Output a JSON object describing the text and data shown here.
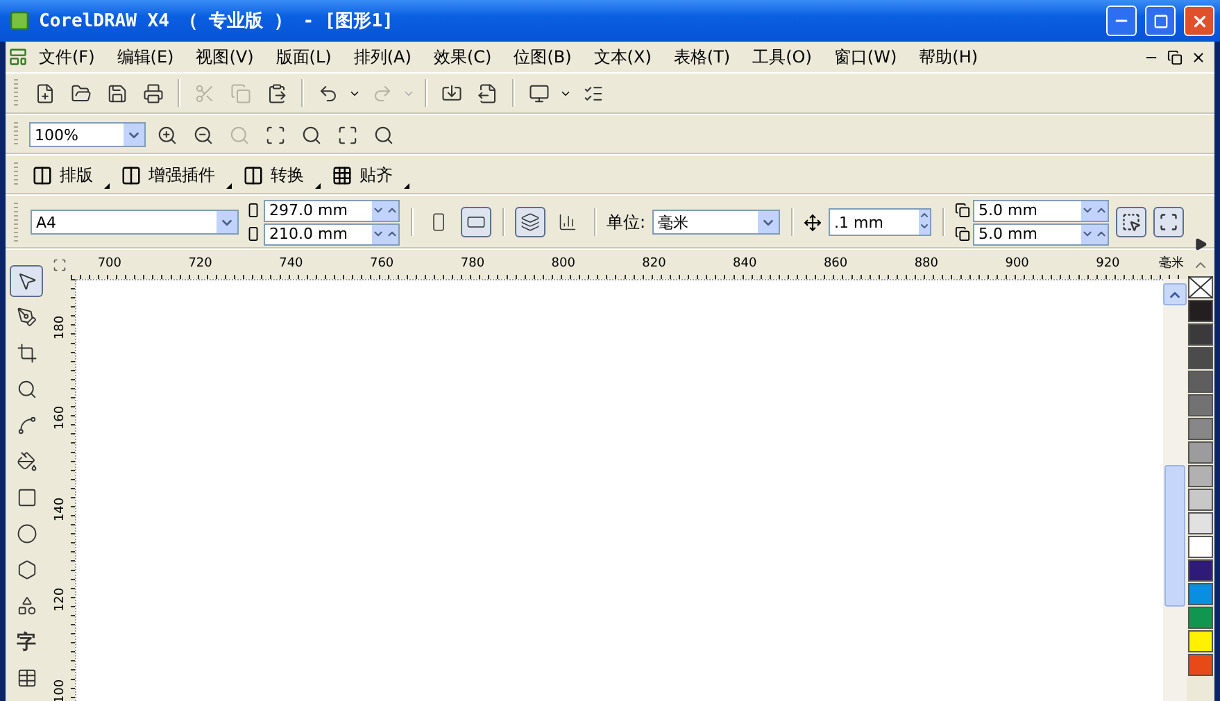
{
  "window": {
    "title": "CorelDRAW X4 （ 专业版 ） - [图形1]"
  },
  "menu": {
    "items": [
      "文件(F)",
      "编辑(E)",
      "视图(V)",
      "版面(L)",
      "排列(A)",
      "效果(C)",
      "位图(B)",
      "文本(X)",
      "表格(T)",
      "工具(O)",
      "窗口(W)",
      "帮助(H)"
    ]
  },
  "zoom_bar": {
    "zoom": "100%"
  },
  "plugin_bar": {
    "items": [
      {
        "kind": "layout",
        "label": "排版"
      },
      {
        "kind": "layout",
        "label": "增强插件"
      },
      {
        "kind": "layout",
        "label": "转换"
      },
      {
        "kind": "snap",
        "label": "贴齐"
      }
    ]
  },
  "property_bar": {
    "paper": "A4",
    "width": "297.0 mm",
    "height": "210.0 mm",
    "orientation": [
      {
        "kind": "portrait",
        "selected": false
      },
      {
        "kind": "landscape",
        "selected": true
      }
    ],
    "page_layout": [
      {
        "kind": "all-pages",
        "selected": true
      },
      {
        "kind": "current-page",
        "selected": false
      }
    ],
    "units_label": "单位:",
    "units": "毫米",
    "nudge": ".1 mm",
    "dup_x": "5.0 mm",
    "dup_y": "5.0 mm"
  },
  "toolbox": [
    {
      "kind": "pick",
      "selected": true
    },
    {
      "kind": "shape",
      "selected": false
    },
    {
      "kind": "crop",
      "selected": false
    },
    {
      "kind": "zoom",
      "selected": false
    },
    {
      "kind": "freehand",
      "selected": false
    },
    {
      "kind": "smart-fill",
      "selected": false
    },
    {
      "kind": "rectangle",
      "selected": false
    },
    {
      "kind": "ellipse",
      "selected": false
    },
    {
      "kind": "polygon",
      "selected": false
    },
    {
      "kind": "basic-shapes",
      "selected": false
    },
    {
      "kind": "text",
      "selected": false,
      "label": "字"
    },
    {
      "kind": "table",
      "selected": false
    }
  ],
  "rulers": {
    "horizontal": [
      "700",
      "720",
      "740",
      "760",
      "780",
      "800",
      "820",
      "840",
      "860",
      "880",
      "900",
      "920"
    ],
    "unit": "毫米",
    "vertical": [
      "180",
      "160",
      "140",
      "120",
      "100"
    ]
  },
  "palette": [
    {
      "kind": "none"
    },
    {
      "kind": "swatch",
      "color": "#231f20"
    },
    {
      "kind": "swatch",
      "color": "#3a3a3a"
    },
    {
      "kind": "swatch",
      "color": "#4b4b4b"
    },
    {
      "kind": "swatch",
      "color": "#5e5e5e"
    },
    {
      "kind": "swatch",
      "color": "#727272"
    },
    {
      "kind": "swatch",
      "color": "#878787"
    },
    {
      "kind": "swatch",
      "color": "#9c9c9c"
    },
    {
      "kind": "swatch",
      "color": "#b1b1b1"
    },
    {
      "kind": "swatch",
      "color": "#c8c8c8"
    },
    {
      "kind": "swatch",
      "color": "#e1e1e1"
    },
    {
      "kind": "swatch",
      "color": "#ffffff"
    },
    {
      "kind": "swatch",
      "color": "#2e1a78"
    },
    {
      "kind": "swatch",
      "color": "#0a8ee0"
    },
    {
      "kind": "swatch",
      "color": "#119650"
    },
    {
      "kind": "swatch",
      "color": "#fff100"
    },
    {
      "kind": "swatch",
      "color": "#e84a17"
    }
  ]
}
